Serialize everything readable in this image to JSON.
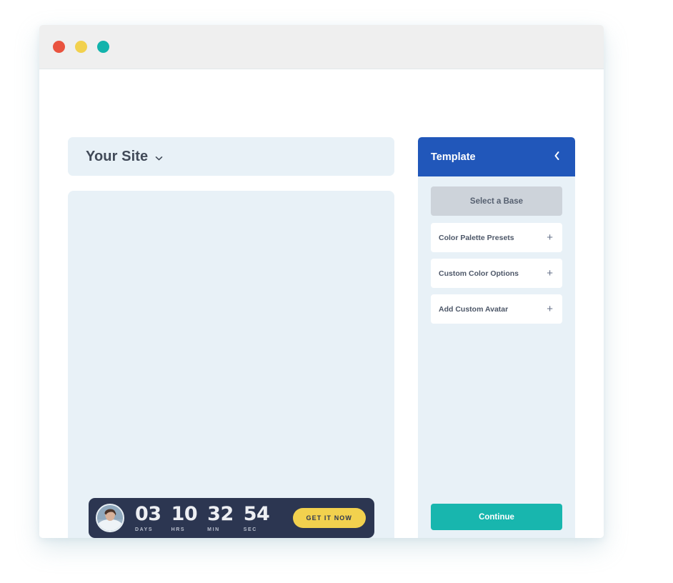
{
  "window": {
    "traffic_lights": [
      {
        "name": "close",
        "color": "#e9533f"
      },
      {
        "name": "minimize",
        "color": "#f2d14e"
      },
      {
        "name": "maximize",
        "color": "#12b3ac"
      }
    ]
  },
  "site_bar": {
    "title": "Your Site",
    "dropdown_icon": "chevron-down-icon"
  },
  "canvas": {
    "countdown": {
      "avatar_icon": "user-portrait-avatar",
      "units": [
        {
          "value": "03",
          "label": "DAYS"
        },
        {
          "value": "10",
          "label": "HRS"
        },
        {
          "value": "32",
          "label": "MIN"
        },
        {
          "value": "54",
          "label": "SEC"
        }
      ],
      "cta_label": "GET IT NOW",
      "cta_color": "#f2d14e",
      "background_color": "#2c3651"
    }
  },
  "panel": {
    "title": "Template",
    "collapse_icon": "chevron-left-icon",
    "header_color": "#2157ba",
    "base_button": {
      "label": "Select a Base",
      "color": "#cdd3da"
    },
    "accordion_items": [
      {
        "label": "Color Palette Presets",
        "expand_icon": "plus-icon",
        "expand_symbol": "+"
      },
      {
        "label": "Custom Color Options",
        "expand_icon": "plus-icon",
        "expand_symbol": "+"
      },
      {
        "label": "Add Custom Avatar",
        "expand_icon": "plus-icon",
        "expand_symbol": "+"
      }
    ],
    "continue_button": {
      "label": "Continue",
      "color": "#18b6ae"
    }
  }
}
